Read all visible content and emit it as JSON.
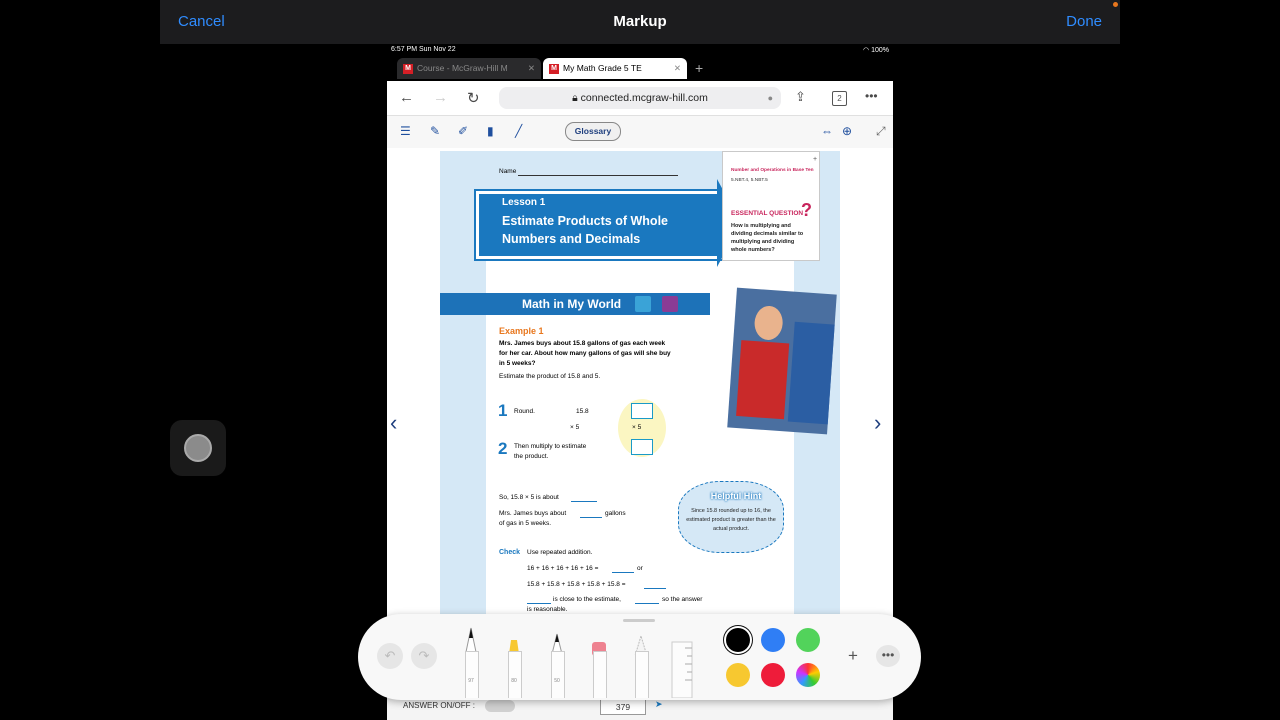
{
  "markup": {
    "cancel": "Cancel",
    "title": "Markup",
    "done": "Done"
  },
  "status": {
    "time": "6:57 PM   Sun Nov 22",
    "battery": "100%"
  },
  "tabs": [
    {
      "icon": "M",
      "label": "Course - McGraw-Hill M"
    },
    {
      "icon": "M",
      "label": "My Math Grade 5 TE"
    }
  ],
  "browser": {
    "url": "connected.mcgraw-hill.com",
    "tab_count": "2"
  },
  "toolbar": {
    "glossary": "Glossary"
  },
  "page": {
    "name_label": "Name",
    "lesson_number": "Lesson 1",
    "lesson_title": "Estimate Products of Whole Numbers and Decimals",
    "standards_label": "Number and Operations in Base Ten",
    "standards": "5.NBT.4, 5.NBT.5",
    "eq_title": "ESSENTIAL QUESTION",
    "eq_text": "How is multiplying and dividing decimals similar to multiplying and dividing whole numbers?",
    "miw_title": "Math in My World",
    "example_title": "Example 1",
    "example_text": "Mrs. James buys about 15.8 gallons of gas each week for her car. About how many gallons of gas will she buy in 5 weeks?",
    "estimate_text": "Estimate the product of 15.8 and 5.",
    "step1_no": "1",
    "step1_text": "Round.",
    "step2_no": "2",
    "step2_text": "Then multiply to estimate the product.",
    "num1": "15.8",
    "num2": "×    5",
    "num3": "×    5",
    "so_text": "So, 15.8 × 5 is about",
    "buys_text": "Mrs. James buys about",
    "gallons": "gallons",
    "weeks": "of gas in 5 weeks.",
    "hint_title": "Helpful Hint",
    "hint_text": "Since 15.8 rounded up to 16, the estimated product is greater than the actual product.",
    "check_title": "Check",
    "check_text": "Use repeated addition.",
    "add1": "16 + 16 + 16 + 16 + 16 =",
    "or": "or",
    "add2": "15.8 + 15.8 + 15.8 + 15.8 + 15.8 =",
    "close": "is close to the estimate,",
    "so_answer": "so the answer",
    "reasonable": "is reasonable."
  },
  "answer_bar": {
    "label": "ANSWER ON/OFF :",
    "page_number": "379"
  },
  "palette": {
    "tool_widths": [
      "97",
      "80",
      "50"
    ],
    "colors": [
      "#000000",
      "#2f7ef5",
      "#52d35b",
      "#f7c830",
      "#ee1c3a",
      "multicolor"
    ]
  }
}
